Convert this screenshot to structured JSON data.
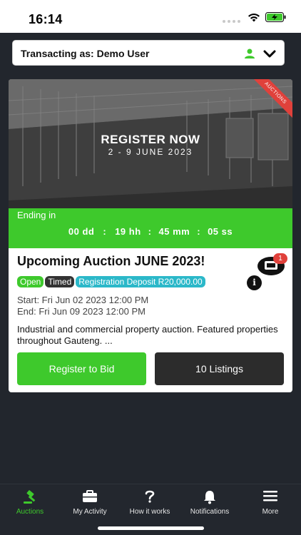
{
  "status": {
    "time": "16:14"
  },
  "transact": {
    "label": "Transacting as: Demo User"
  },
  "card": {
    "banner_title": "REGISTER NOW",
    "banner_dates": "2 - 9 JUNE 2023",
    "ribbon": "AUCTIONS",
    "ending_label": "Ending in",
    "countdown": {
      "days": "00 dd",
      "hours": "19 hh",
      "minutes": "45 mm",
      "seconds": "05 ss",
      "sep": ":"
    },
    "title": "Upcoming Auction JUNE 2023!",
    "chat_badge": "1",
    "info_glyph": "i",
    "tags": {
      "open": "Open",
      "timed": "Timed",
      "deposit": "Registration Deposit R20,000.00"
    },
    "start": "Start: Fri Jun 02 2023 12:00 PM",
    "end": "End: Fri Jun 09 2023 12:00 PM",
    "description": "Industrial and commercial property auction. Featured properties throughout Gauteng. ...",
    "register_btn": "Register to Bid",
    "listings_btn": "10 Listings"
  },
  "tabs": [
    {
      "label": "Auctions",
      "icon": "gavel-icon",
      "active": true
    },
    {
      "label": "My Activity",
      "icon": "briefcase-icon",
      "active": false
    },
    {
      "label": "How it works",
      "icon": "question-icon",
      "active": false
    },
    {
      "label": "Notifications",
      "icon": "bell-icon",
      "active": false
    },
    {
      "label": "More",
      "icon": "menu-icon",
      "active": false
    }
  ],
  "colors": {
    "accent": "#3ec92c",
    "dark": "#22262d",
    "badge": "#e0413b",
    "deposit": "#2bb8c9"
  }
}
